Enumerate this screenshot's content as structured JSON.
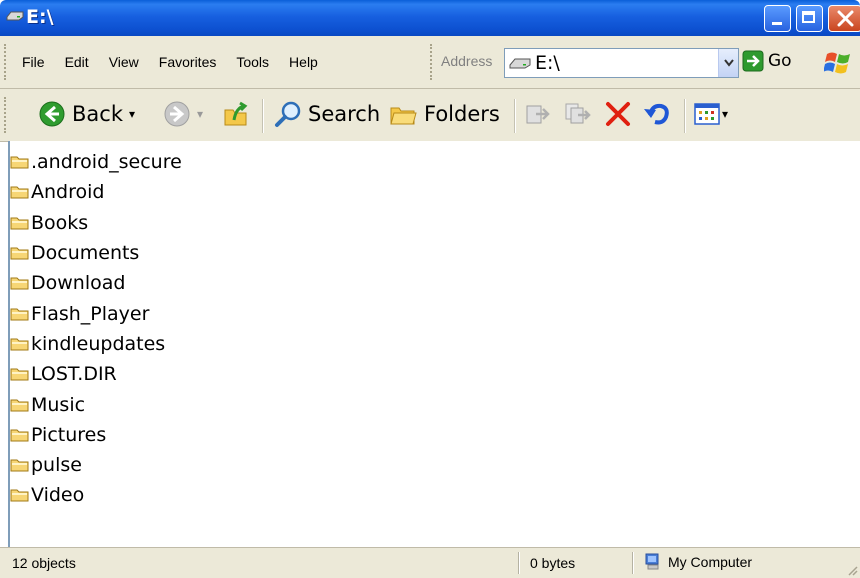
{
  "window": {
    "title": "E:\\"
  },
  "menu": [
    "File",
    "Edit",
    "View",
    "Favorites",
    "Tools",
    "Help"
  ],
  "address": {
    "label": "Address",
    "value": "E:\\",
    "go_label": "Go"
  },
  "toolbar": {
    "back_label": "Back",
    "search_label": "Search",
    "folders_label": "Folders"
  },
  "folders": [
    ".android_secure",
    "Android",
    "Books",
    "Documents",
    "Download",
    "Flash_Player",
    "kindleupdates",
    "LOST.DIR",
    "Music",
    "Pictures",
    "pulse",
    "Video"
  ],
  "status": {
    "objects": "12 objects",
    "size": "0 bytes",
    "location": "My Computer"
  },
  "icons": {
    "title": "drive-icon",
    "back": "back-arrow-icon",
    "forward": "forward-arrow-icon",
    "up": "up-folder-icon",
    "search": "search-icon",
    "folders": "folders-icon",
    "move_to": "move-to-icon",
    "copy_to": "copy-to-icon",
    "delete": "delete-icon",
    "undo": "undo-icon",
    "views": "views-icon",
    "folder": "folder-icon"
  },
  "colors": {
    "title_bar": "#0c4fcf",
    "chrome": "#ece9d8",
    "delete_red": "#e02010",
    "go_green": "#2e9a2e"
  }
}
